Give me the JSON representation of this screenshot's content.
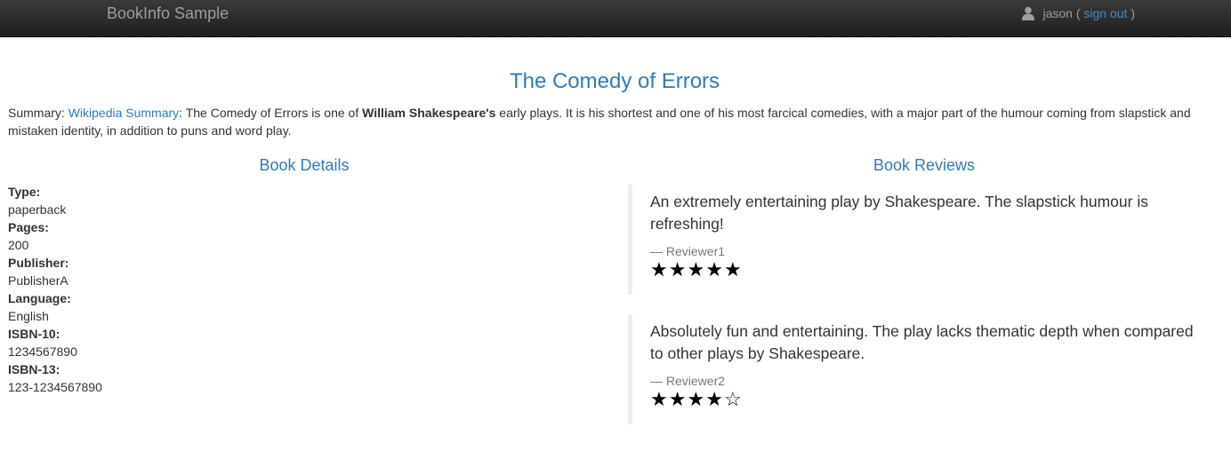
{
  "navbar": {
    "brand": "BookInfo Sample",
    "user_icon": "user-icon",
    "username": "jason",
    "paren_open": "(",
    "sign_out_label": "sign out",
    "paren_close": ")"
  },
  "book": {
    "title": "The Comedy of Errors",
    "summary": {
      "prefix": "Summary: ",
      "link_label": "Wikipedia Summary",
      "text_before_bold": ": The Comedy of Errors is one of ",
      "bold": "William Shakespeare's",
      "text_after_bold": " early plays. It is his shortest and one of his most farcical comedies, with a major part of the humour coming from slapstick and mistaken identity, in addition to puns and word play."
    }
  },
  "details": {
    "heading": "Book Details",
    "fields": [
      {
        "label": "Type:",
        "value": "paperback"
      },
      {
        "label": "Pages:",
        "value": "200"
      },
      {
        "label": "Publisher:",
        "value": "PublisherA"
      },
      {
        "label": "Language:",
        "value": "English"
      },
      {
        "label": "ISBN-10:",
        "value": "1234567890"
      },
      {
        "label": "ISBN-13:",
        "value": "123-1234567890"
      }
    ]
  },
  "reviews": {
    "heading": "Book Reviews",
    "items": [
      {
        "text": "An extremely entertaining play by Shakespeare. The slapstick humour is refreshing!",
        "reviewer": "— Reviewer1",
        "rating": 5,
        "max_rating": 5,
        "star_color": "#000000"
      },
      {
        "text": "Absolutely fun and entertaining. The play lacks thematic depth when compared to other plays by Shakespeare.",
        "reviewer": "— Reviewer2",
        "rating": 4,
        "max_rating": 5,
        "star_color": "#000000"
      }
    ]
  },
  "colors": {
    "link": "#337ab7",
    "navbar_bg": "#222222",
    "navbar_text": "#9d9d9d"
  }
}
